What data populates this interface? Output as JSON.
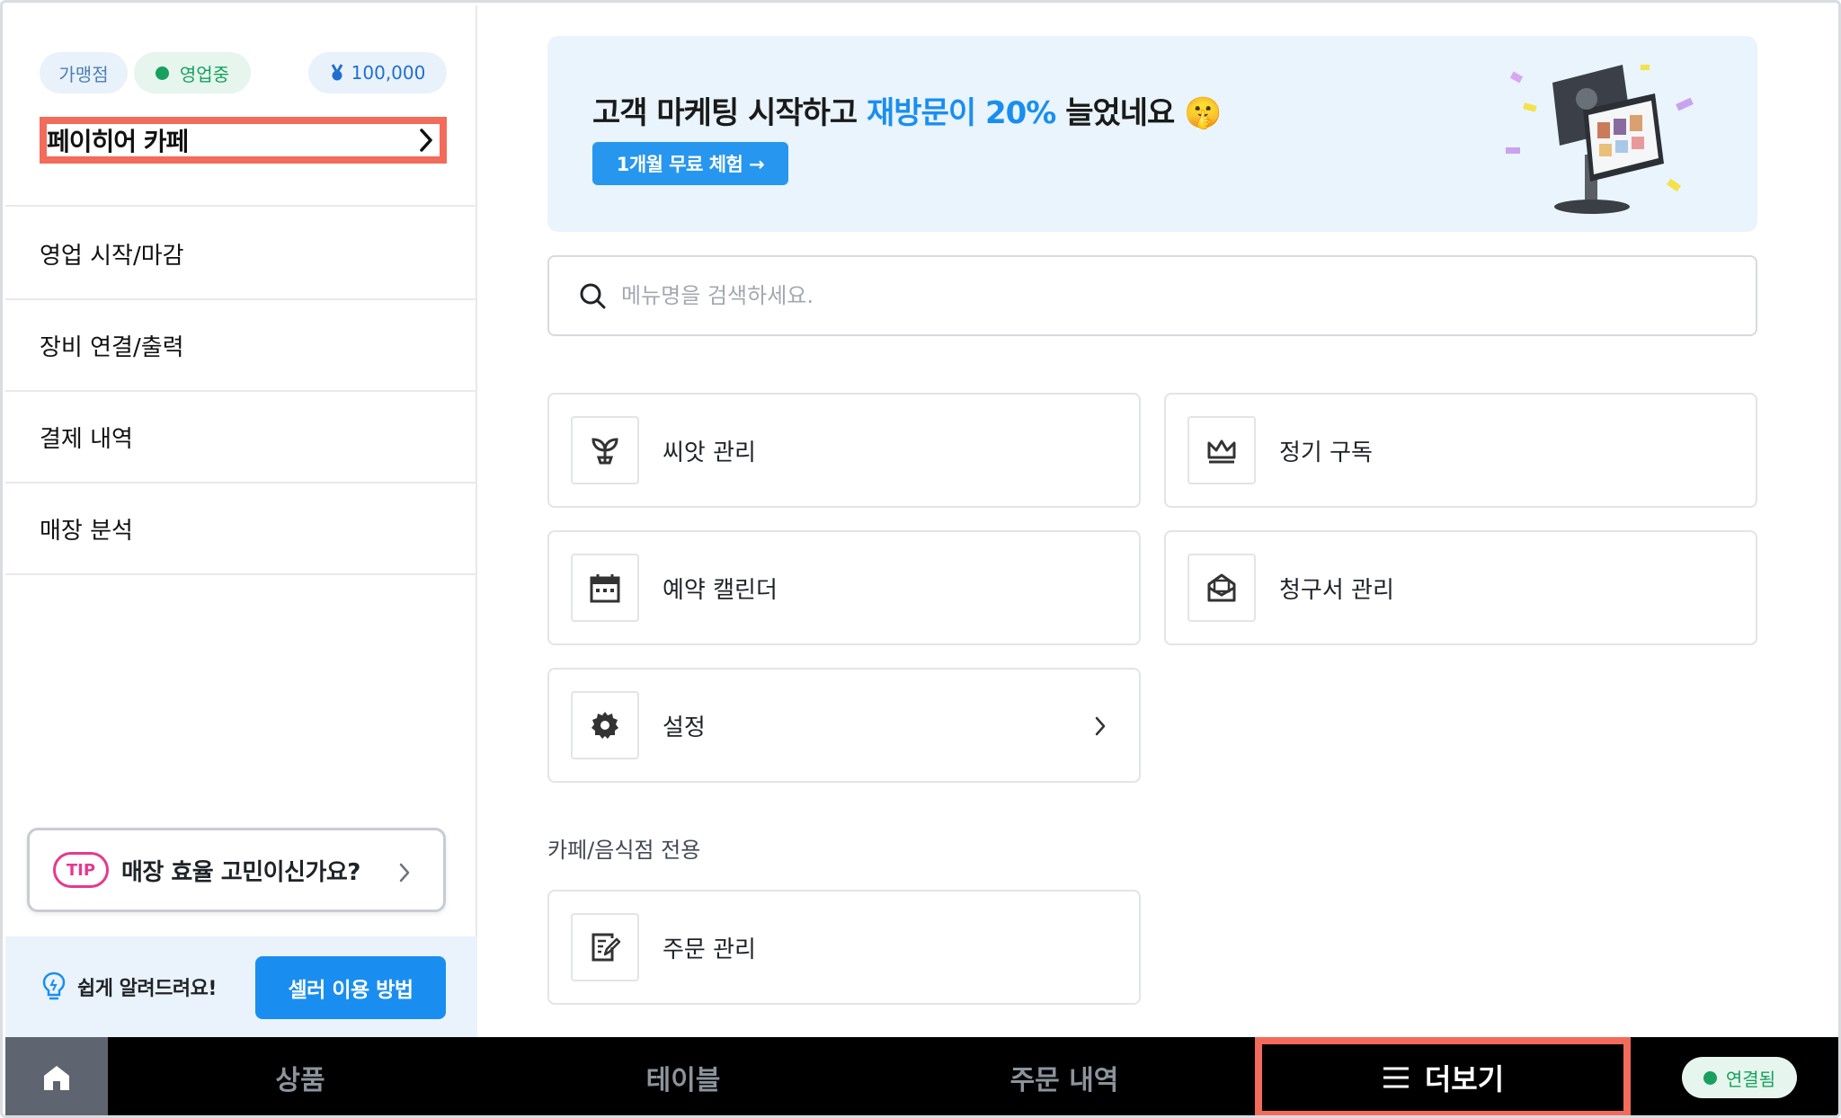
{
  "sidebar": {
    "chips": {
      "store_type": "가맹점",
      "status": "영업중",
      "points": "100,000"
    },
    "store_name": "페이히어 카페",
    "items": [
      {
        "label": "영업 시작/마감"
      },
      {
        "label": "장비 연결/출력"
      },
      {
        "label": "결제 내역"
      },
      {
        "label": "매장 분석"
      }
    ],
    "tip": {
      "badge": "TIP",
      "text": "매장 효율 고민이신가요?"
    },
    "help": {
      "text": "쉽게 알려드려요!",
      "button": "셀러 이용 방법"
    }
  },
  "banner": {
    "title_prefix": "고객 마케팅 시작하고 ",
    "title_highlight": "재방문이 20%",
    "title_suffix": " 늘었네요",
    "emoji": "🤫",
    "button": "1개월 무료 체험 →"
  },
  "search": {
    "placeholder": "메뉴명을 검색하세요."
  },
  "menu": {
    "seed": "씨앗 관리",
    "subscription": "정기 구독",
    "calendar": "예약 캘린더",
    "invoice": "청구서 관리",
    "settings": "설정",
    "section_title": "카페/음식점 전용",
    "orders": "주문 관리"
  },
  "bottom_nav": {
    "products": "상품",
    "table": "테이블",
    "order_history": "주문 내역",
    "more": "더보기",
    "connection": "연결됨"
  },
  "colors": {
    "accent": "#1a8ef0",
    "highlight_border": "#f26b5b",
    "success": "#18a05e",
    "tip_pink": "#e6398e"
  }
}
